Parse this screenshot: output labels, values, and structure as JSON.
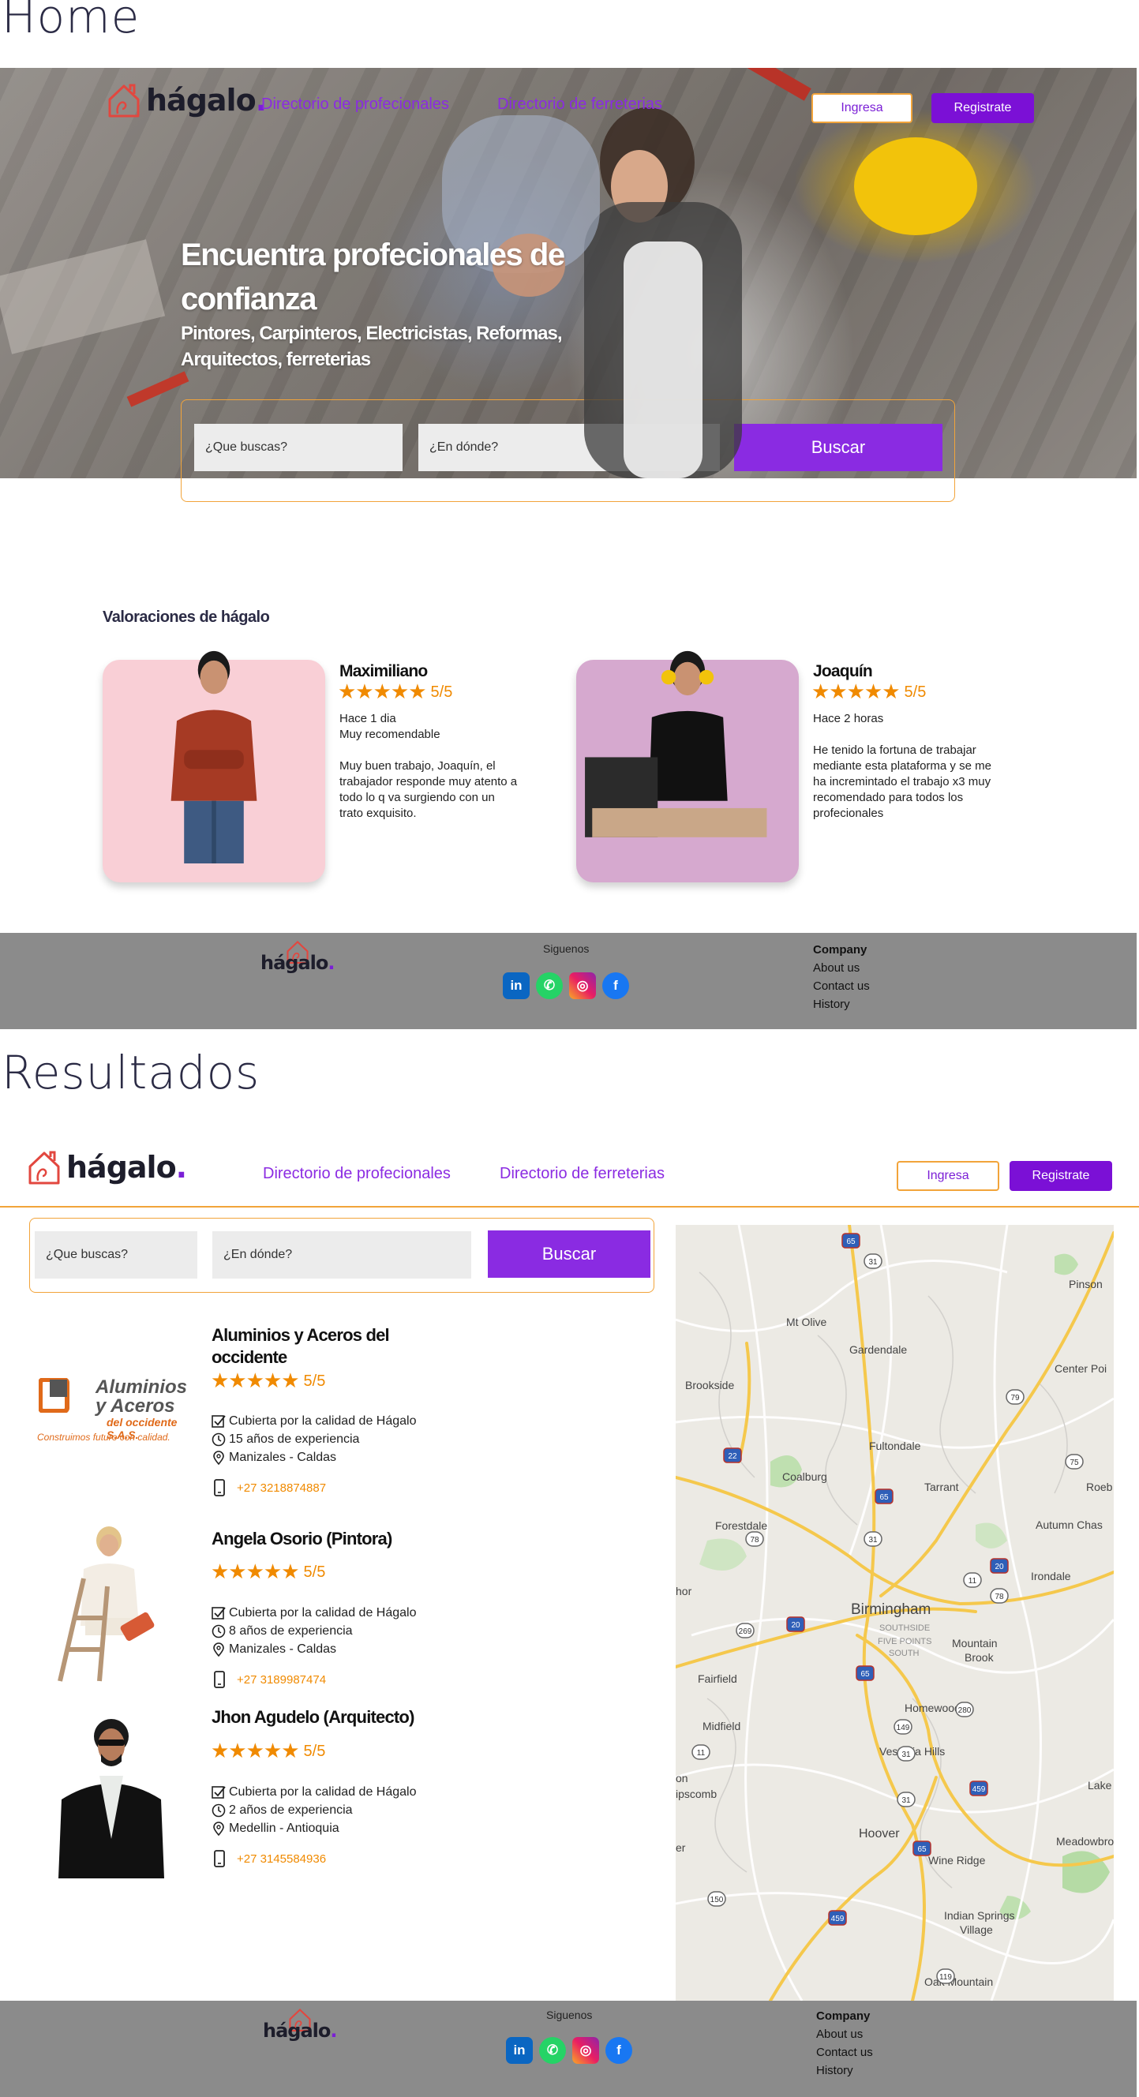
{
  "home": {
    "section_title": "Home",
    "nav": {
      "logo_text": "hágalo",
      "logo_dot": ".",
      "link_professionals": "Directorio de profecionales",
      "link_hardware": "Directorio de ferreterias",
      "login_label": "Ingresa",
      "register_label": "Registrate"
    },
    "hero": {
      "title": "Encuentra profecionales de confianza",
      "subtitle": "Pintores, Carpinteros, Electricistas, Reformas, Arquitectos, ferreterias"
    },
    "search": {
      "what_placeholder": "¿Que buscas?",
      "where_placeholder": "¿En dónde?",
      "button_label": "Buscar"
    },
    "reviews": {
      "title": "Valoraciones de hágalo",
      "items": [
        {
          "name": "Maximiliano",
          "stars": "★★★★★",
          "score": "5/5",
          "time": "Hace 1 dia",
          "headline": "Muy recomendable",
          "body": "Muy buen trabajo, Joaquín, el trabajador responde muy atento a todo lo q va surgiendo con un trato exquisito."
        },
        {
          "name": "Joaquín",
          "stars": "★★★★★",
          "score": "5/5",
          "time": "Hace 2 horas",
          "headline": "",
          "body": "He tenido la fortuna de trabajar mediante esta plataforma y se me ha incremintado el trabajo x3 muy recomendado para todos los profecionales"
        }
      ]
    }
  },
  "footer": {
    "logo_text": "hágalo",
    "logo_dot": ".",
    "follow_label": "Siguenos",
    "company_title": "Company",
    "links": [
      "About us",
      "Contact us",
      "History"
    ],
    "social_icons": [
      "linkedin-icon",
      "whatsapp-icon",
      "instagram-icon",
      "facebook-icon"
    ]
  },
  "results": {
    "section_title": "Resultados",
    "items": [
      {
        "name_line1": "Aluminios y Aceros del",
        "name_line2": "occidente",
        "stars": "★★★★★",
        "score": "5/5",
        "coverage": "Cubierta por la calidad de Hágalo",
        "experience": "15 años de experiencia",
        "location": "Manizales - Caldas",
        "phone": "+27 3218874887",
        "logo_line1": "Aluminios",
        "logo_line2": "y Aceros",
        "logo_line3": "del occidente S.A.S.",
        "logo_tagline": "Construimos futuro con calidad."
      },
      {
        "name_line1": "Angela Osorio (Pintora)",
        "name_line2": "",
        "stars": "★★★★★",
        "score": "5/5",
        "coverage": "Cubierta por la calidad de Hágalo",
        "experience": "8 años de experiencia",
        "location": "Manizales - Caldas",
        "phone": "+27 3189987474"
      },
      {
        "name_line1": "Jhon Agudelo (Arquitecto)",
        "name_line2": "",
        "stars": "★★★★★",
        "score": "5/5",
        "coverage": "Cubierta por la calidad de Hágalo",
        "experience": "2 años de experiencia",
        "location": "Medellin - Antioquia",
        "phone": "+27 3145584936"
      }
    ],
    "map": {
      "places": [
        "Mt Olive",
        "Gardendale",
        "Pinson",
        "Center Poi",
        "Brookside",
        "Fultondale",
        "Coalburg",
        "Tarrant",
        "Roeb",
        "Forestdale",
        "Autumn Chas",
        "Irondale",
        "Birmingham",
        "SOUTHSIDE",
        "FIVE POINTS",
        "SOUTH",
        "Mountain",
        "Brook",
        "Fairfield",
        "Homewood",
        "Midfield",
        "Vestavia Hills",
        "ipscomb",
        "Lake Pur",
        "Hoover",
        "Meadowbrook",
        "Wine Ridge",
        "Indian Springs",
        "Village",
        "Oak Mountain",
        "er",
        "on",
        "hor"
      ],
      "shields": [
        "65",
        "31",
        "79",
        "75",
        "22",
        "65",
        "78",
        "31",
        "20",
        "11",
        "78",
        "269",
        "20",
        "65",
        "280",
        "149",
        "31",
        "11",
        "459",
        "31",
        "65",
        "150",
        "459",
        "119"
      ]
    }
  }
}
